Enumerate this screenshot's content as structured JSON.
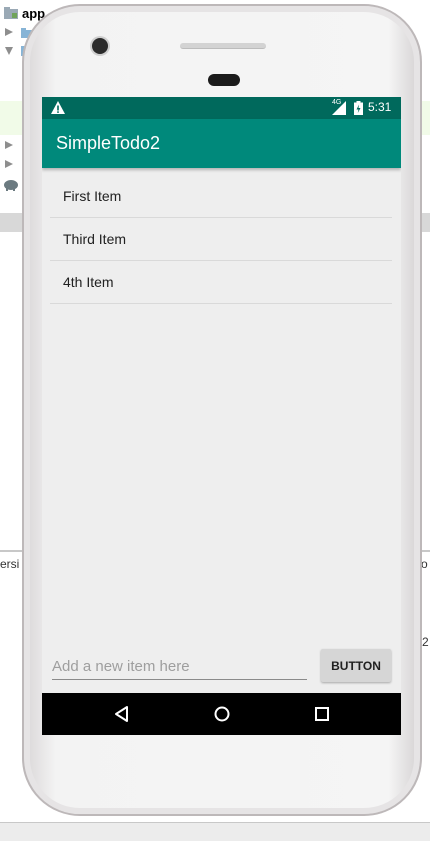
{
  "ide": {
    "project_label": "app",
    "bottom_left_fragment": "ersi",
    "bottom_right_fragment": "o",
    "side_number": "2"
  },
  "status_bar": {
    "time": "5:31",
    "network": "4G",
    "warning_icon": "warning-icon",
    "signal_icon": "signal-icon",
    "battery_icon": "battery-icon",
    "color": "#00695c"
  },
  "app_bar": {
    "title": "SimpleTodo2",
    "color": "#00897b"
  },
  "todo_list": {
    "items": [
      {
        "label": "First Item"
      },
      {
        "label": "Third Item"
      },
      {
        "label": "4th Item"
      }
    ]
  },
  "input": {
    "placeholder": "Add a new item here",
    "value": ""
  },
  "add_button": {
    "label": "BUTTON"
  },
  "nav_bar": {
    "back_icon": "back-triangle-icon",
    "home_icon": "home-circle-icon",
    "recents_icon": "recents-square-icon"
  }
}
